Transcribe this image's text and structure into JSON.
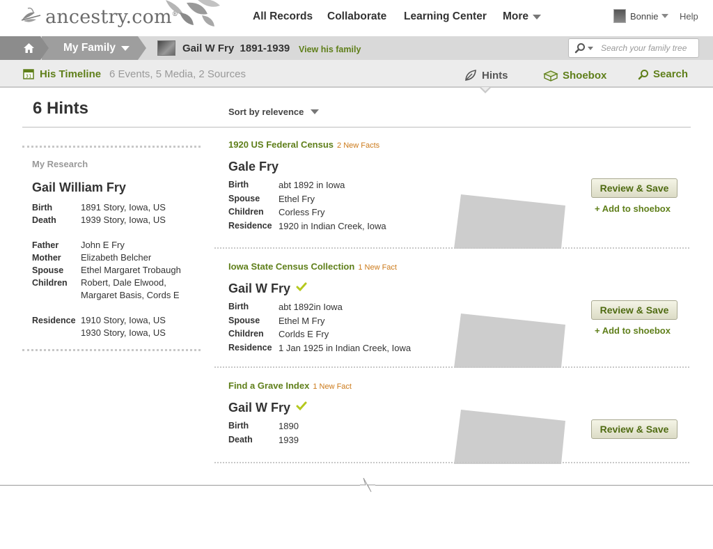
{
  "brand": {
    "name": "ancestry.com",
    "name_main": "ancestry",
    "name_suffix": ".com",
    "reg": "®"
  },
  "nav": {
    "all_records": "All Records",
    "collaborate": "Collaborate",
    "learning_center": "Learning Center",
    "more": "More",
    "user": "Bonnie",
    "help": "Help"
  },
  "breadcrumb": {
    "family": "My Family",
    "person": "Gail W Fry  1891-1939",
    "view_family": "View his family"
  },
  "search": {
    "placeholder": "Search your family tree"
  },
  "timeline": {
    "label": "His Timeline",
    "meta": "6 Events, 5 Media, 2 Sources"
  },
  "tabs": {
    "hints": "Hints",
    "shoebox": "Shoebox",
    "search": "Search"
  },
  "content": {
    "title": "6 Hints",
    "sort_label": "Sort by relevence"
  },
  "research": {
    "heading": "My Research",
    "name": "Gail William Fry",
    "birth_label": "Birth",
    "birth": "1891 Story, Iowa, US",
    "death_label": "Death",
    "death": "1939 Story, Iowa, US",
    "father_label": "Father",
    "father": "John E Fry",
    "mother_label": "Mother",
    "mother": "Elizabeth Belcher",
    "spouse_label": "Spouse",
    "spouse": "Ethel Margaret Trobaugh",
    "children_label": "Children",
    "children_1": "Robert, Dale Elwood,",
    "children_2": "Margaret Basis, Cords E",
    "residence_label": "Residence",
    "residence_1": "1910 Story, Iowa, US",
    "residence_2": "1930 Story, Iowa, US"
  },
  "hints": [
    {
      "source": "1920 US Federal Census",
      "new_facts": "2 New Facts",
      "name": "Gale Fry",
      "facts": [
        {
          "k": "Birth",
          "v": "abt 1892 in Iowa"
        },
        {
          "k": "Spouse",
          "v": "Ethel Fry"
        },
        {
          "k": "Children",
          "v": "Corless Fry"
        },
        {
          "k": "Residence",
          "v": "1920 in Indian Creek, Iowa"
        }
      ],
      "review": "Review & Save",
      "add": "+ Add to shoebox"
    },
    {
      "source": "Iowa State Census Collection",
      "new_facts": "1 New Fact",
      "name": "Gail W Fry",
      "facts": [
        {
          "k": "Birth",
          "v": "abt 1892in Iowa"
        },
        {
          "k": "Spouse",
          "v": "Ethel M Fry"
        },
        {
          "k": "Children",
          "v": "Corlds E Fry"
        },
        {
          "k": "Residence",
          "v": "1 Jan 1925 in Indian Creek, Iowa"
        }
      ],
      "review": "Review & Save",
      "add": "+ Add to shoebox"
    },
    {
      "source": "Find a Grave Index",
      "new_facts": "1 New Fact",
      "name": "Gail W Fry",
      "facts": [
        {
          "k": "Birth",
          "v": "1890"
        },
        {
          "k": "Death",
          "v": "1939"
        }
      ],
      "review": "Review & Save"
    }
  ],
  "colors": {
    "accent_green": "#5f7f1a",
    "new_fact_orange": "#cc7a1a",
    "check_green": "#b5c81e"
  },
  "icons": [
    "home-icon",
    "search-icon",
    "calendar-icon",
    "leaf-icon",
    "shoebox-icon",
    "checkmark-icon"
  ]
}
